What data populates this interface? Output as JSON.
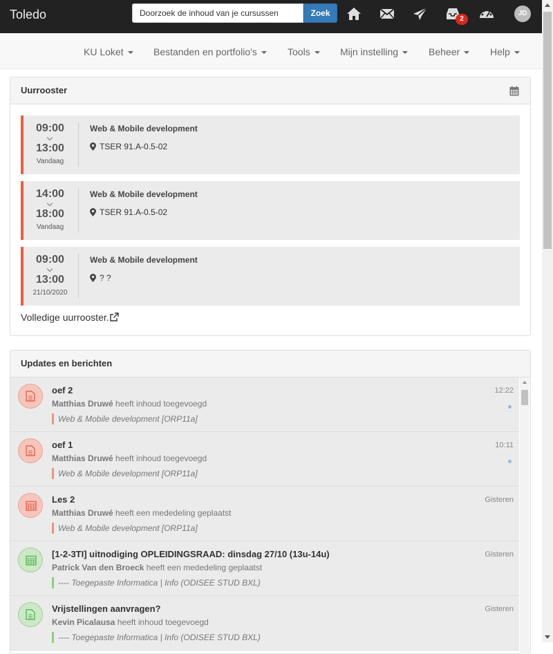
{
  "app": {
    "brand": "Toledo"
  },
  "search": {
    "placeholder": "Doorzoek de inhoud van je cursussen",
    "button": "Zoek"
  },
  "topnav": {
    "icons": [
      "home-icon",
      "mail-icon",
      "send-icon",
      "inbox-icon",
      "dashboard-icon"
    ],
    "inbox_badge": "2",
    "avatar_initials": "JD"
  },
  "menu": {
    "items": [
      "KU Loket",
      "Bestanden en portfolio's",
      "Tools",
      "Mijn instelling",
      "Beheer",
      "Help"
    ]
  },
  "schedule": {
    "title": "Uurrooster",
    "items": [
      {
        "start": "09:00",
        "end": "13:00",
        "day": "Vandaag",
        "course": "Web & Mobile development",
        "location": "TSER 91.A-0.5-02"
      },
      {
        "start": "14:00",
        "end": "18:00",
        "day": "Vandaag",
        "course": "Web & Mobile development",
        "location": "TSER 91.A-0.5-02"
      },
      {
        "start": "09:00",
        "end": "13:00",
        "day": "21/10/2020",
        "course": "Web & Mobile development",
        "location": "? ?"
      }
    ],
    "full_link": "Volledige uurrooster."
  },
  "updates": {
    "title": "Updates en berichten",
    "items": [
      {
        "title": "oef 2",
        "author": "Matthias Druwé",
        "action": "heeft inhoud toegevoegd",
        "course": "Web & Mobile development [ORP11a]",
        "time": "12:22",
        "icon": "document-icon",
        "color": "red",
        "unread": true
      },
      {
        "title": "oef 1",
        "author": "Matthias Druwé",
        "action": "heeft inhoud toegevoegd",
        "course": "Web & Mobile development [ORP11a]",
        "time": "10:11",
        "icon": "document-icon",
        "color": "red",
        "unread": true
      },
      {
        "title": "Les 2",
        "author": "Matthias Druwé",
        "action": "heeft een mededeling geplaatst",
        "course": "Web & Mobile development [ORP11a]",
        "time": "Gisteren",
        "icon": "calendar-icon",
        "color": "red",
        "unread": false
      },
      {
        "title": "[1-2-3TI] uitnodiging OPLEIDINGSRAAD: dinsdag 27/10 (13u-14u)",
        "author": "Patrick Van den Broeck",
        "action": "heeft een mededeling geplaatst",
        "course": "---- Toegepaste Informatica | Info (ODISEE STUD BXL)",
        "time": "Gisteren",
        "icon": "calendar-icon",
        "color": "green",
        "unread": false
      },
      {
        "title": "Vrijstellingen aanvragen?",
        "author": "Kevin Picalausa",
        "action": "heeft inhoud toegevoegd",
        "course": "---- Toegepaste Informatica | Info (ODISEE STUD BXL)",
        "time": "Gisteren",
        "icon": "document-icon",
        "color": "green",
        "unread": false
      }
    ]
  },
  "colors": {
    "topbar": "#222222",
    "accent": "#337ab7",
    "schedule_border": "#ef5d3f",
    "badge": "#d9281f"
  }
}
